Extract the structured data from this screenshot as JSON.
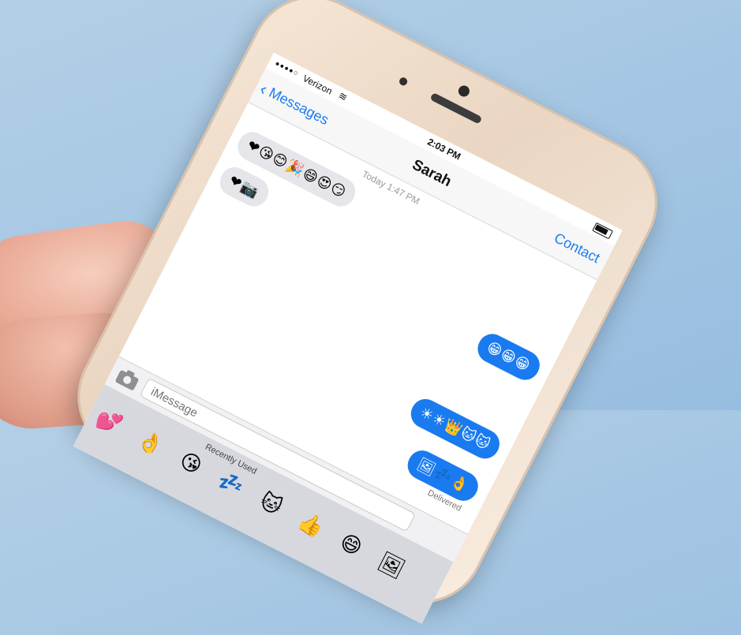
{
  "status_bar": {
    "signal": "●●●●○",
    "carrier": "Verizon",
    "wifi_icon": "wifi-icon",
    "time": "2:03 PM",
    "battery_icon": "battery-icon"
  },
  "nav": {
    "back_label": "Messages",
    "title": "Sarah",
    "contact_label": "Contact"
  },
  "conversation": {
    "previous_preview": "Today 1:47 PM",
    "messages": [
      {
        "direction": "incoming",
        "text": "❤😘😊🎉😄😍😏"
      },
      {
        "direction": "incoming",
        "text": "❤📷"
      },
      {
        "direction": "outgoing",
        "text": "😁😁😁"
      },
      {
        "direction": "outgoing",
        "text": "☀☀👑🐱🐱"
      },
      {
        "direction": "outgoing",
        "text": "🖼💤👌"
      }
    ],
    "delivered_label": "Delivered"
  },
  "input": {
    "placeholder": "iMessage"
  },
  "keyboard": {
    "section_label": "Recently Used",
    "emojis": [
      "💕",
      "👌",
      "😘",
      "💤",
      "🐱",
      "👍",
      "😄",
      "🖼"
    ]
  },
  "colors": {
    "ios_blue": "#1a7bf0",
    "incoming_bubble": "#e5e5ea",
    "phone_gold": "#f5e6d6",
    "background_blue": "#a6c7e3"
  }
}
